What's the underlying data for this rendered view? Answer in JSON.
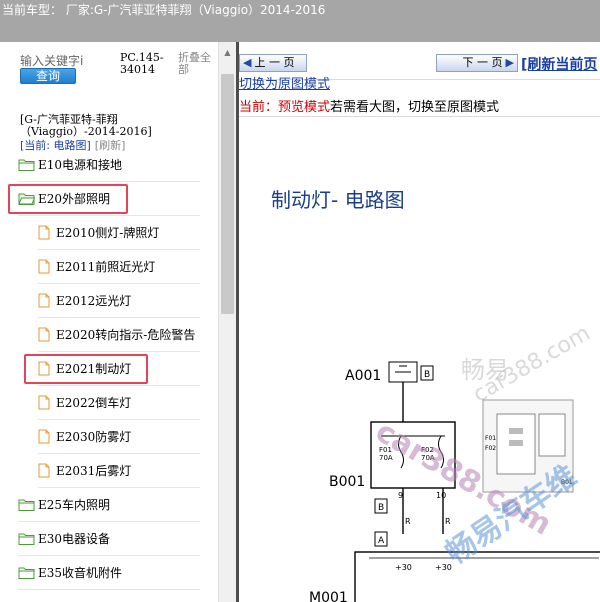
{
  "window": {
    "title": "当前车型：  厂家:G-广汽菲亚特菲翔（Viaggio）2014-2016"
  },
  "sidebar": {
    "search_placeholder": "输入关键字i",
    "search_button": "查询",
    "pc_code_line1": "PC.145-",
    "pc_code_line2": "34014",
    "collapse_line1": "折叠全",
    "collapse_line2": "部",
    "car_path_line1": "[G-广汽菲亚特-菲翔",
    "car_path_line2": "（Viaggio）-2014-2016]",
    "current_label": "[当前: 电路图]",
    "refresh_label": "[刷新]",
    "tree": [
      {
        "label": "E10电源和接地",
        "type": "folder",
        "level": 0
      },
      {
        "label": "E20外部照明",
        "type": "folder-open",
        "level": 0,
        "highlighted": true
      },
      {
        "label": "E2010侧灯-牌照灯",
        "type": "doc",
        "level": 1
      },
      {
        "label": "E2011前照近光灯",
        "type": "doc",
        "level": 1
      },
      {
        "label": "E2012远光灯",
        "type": "doc",
        "level": 1
      },
      {
        "label": "E2020转向指示-危险警告",
        "type": "doc",
        "level": 1
      },
      {
        "label": "E2021制动灯",
        "type": "doc",
        "level": 1,
        "highlighted": true
      },
      {
        "label": "E2022倒车灯",
        "type": "doc",
        "level": 1
      },
      {
        "label": "E2030防雾灯",
        "type": "doc",
        "level": 1
      },
      {
        "label": "E2031后雾灯",
        "type": "doc",
        "level": 1
      },
      {
        "label": "E25车内照明",
        "type": "folder",
        "level": 0
      },
      {
        "label": "E30电器设备",
        "type": "folder",
        "level": 0
      },
      {
        "label": "E35收音机附件",
        "type": "folder",
        "level": 0
      }
    ]
  },
  "main": {
    "prev_button": "上 一 页",
    "next_button": "下 一 页",
    "refresh_page": "[刷新当前页",
    "mode_link": "切换为原图模式",
    "mode_current": "当前：",
    "mode_preview": "预览模式",
    "mode_hint": "若需看大图，切换至原图模式"
  },
  "diagram": {
    "title": "制动灯- 电路图",
    "labels": {
      "a001": "A001",
      "b001": "B001",
      "m001": "M001",
      "f01": "F01",
      "f02": "F02",
      "amp1": "70A",
      "amp2": "70A",
      "wire1": "9",
      "wire2": "10",
      "box_b": "B",
      "box_a": "A",
      "r": "R",
      "p30a": "+30",
      "p30b": "+30",
      "inset_f01": "F01",
      "inset_f02": "F02",
      "inset_b01": "B01"
    }
  },
  "watermark": {
    "text1": "畅易",
    "text2": "car388.com",
    "text3": "car388.com",
    "text4": "畅易汽车维"
  },
  "colors": {
    "highlight": "#e1455a",
    "link": "#1a3fa0",
    "preview_red": "#d00000",
    "titlebar": "#a6a6a6"
  }
}
